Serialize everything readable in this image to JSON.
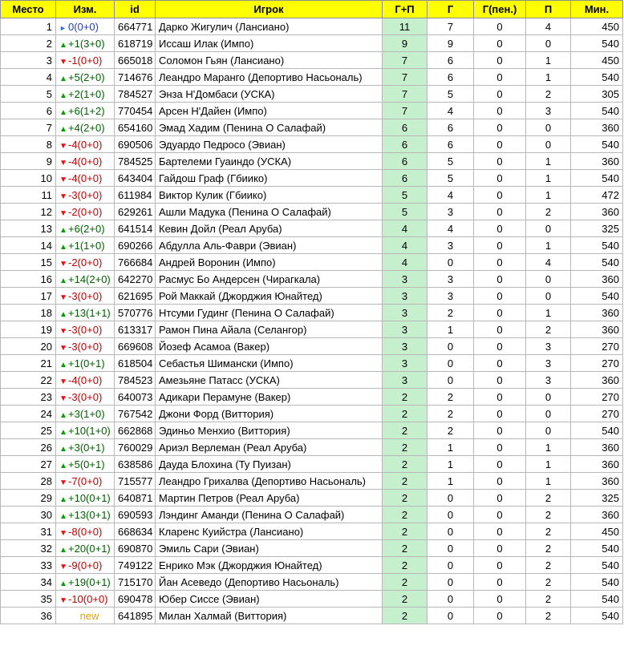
{
  "columns": {
    "place": "Место",
    "change": "Изм.",
    "id": "id",
    "player": "Игрок",
    "gp": "Г+П",
    "goals": "Г",
    "pen": "Г(пен.)",
    "assists": "П",
    "minutes": "Мин."
  },
  "rows": [
    {
      "place": "1",
      "dir": "same",
      "arrow": "►",
      "change": "0(0+0)",
      "id": "664771",
      "player": "Дарко Жигулич (Лансиано)",
      "gp": "11",
      "goals": "7",
      "pen": "0",
      "assists": "4",
      "minutes": "450"
    },
    {
      "place": "2",
      "dir": "up",
      "arrow": "▲",
      "change": "+1(3+0)",
      "id": "618719",
      "player": "Иссаш Илак (Импо)",
      "gp": "9",
      "goals": "9",
      "pen": "0",
      "assists": "0",
      "minutes": "540"
    },
    {
      "place": "3",
      "dir": "down",
      "arrow": "▼",
      "change": "-1(0+0)",
      "id": "665018",
      "player": "Соломон Гьян (Лансиано)",
      "gp": "7",
      "goals": "6",
      "pen": "0",
      "assists": "1",
      "minutes": "450"
    },
    {
      "place": "4",
      "dir": "up",
      "arrow": "▲",
      "change": "+5(2+0)",
      "id": "714676",
      "player": "Леандро Маранго (Депортиво Насьональ)",
      "gp": "7",
      "goals": "6",
      "pen": "0",
      "assists": "1",
      "minutes": "540"
    },
    {
      "place": "5",
      "dir": "up",
      "arrow": "▲",
      "change": "+2(1+0)",
      "id": "784527",
      "player": "Энза Н'Домбаси (УСКА)",
      "gp": "7",
      "goals": "5",
      "pen": "0",
      "assists": "2",
      "minutes": "305"
    },
    {
      "place": "6",
      "dir": "up",
      "arrow": "▲",
      "change": "+6(1+2)",
      "id": "770454",
      "player": "Арсен Н'Дайен (Импо)",
      "gp": "7",
      "goals": "4",
      "pen": "0",
      "assists": "3",
      "minutes": "540"
    },
    {
      "place": "7",
      "dir": "up",
      "arrow": "▲",
      "change": "+4(2+0)",
      "id": "654160",
      "player": "Эмад Хадим (Пенина О Салафай)",
      "gp": "6",
      "goals": "6",
      "pen": "0",
      "assists": "0",
      "minutes": "360"
    },
    {
      "place": "8",
      "dir": "down",
      "arrow": "▼",
      "change": "-4(0+0)",
      "id": "690506",
      "player": "Эдуардо Педросо (Эвиан)",
      "gp": "6",
      "goals": "6",
      "pen": "0",
      "assists": "0",
      "minutes": "540"
    },
    {
      "place": "9",
      "dir": "down",
      "arrow": "▼",
      "change": "-4(0+0)",
      "id": "784525",
      "player": "Бартелеми Гуаиндо (УСКА)",
      "gp": "6",
      "goals": "5",
      "pen": "0",
      "assists": "1",
      "minutes": "360"
    },
    {
      "place": "10",
      "dir": "down",
      "arrow": "▼",
      "change": "-4(0+0)",
      "id": "643404",
      "player": "Гайдош Граф (Гбиико)",
      "gp": "6",
      "goals": "5",
      "pen": "0",
      "assists": "1",
      "minutes": "540"
    },
    {
      "place": "11",
      "dir": "down",
      "arrow": "▼",
      "change": "-3(0+0)",
      "id": "611984",
      "player": "Виктор Кулик (Гбиико)",
      "gp": "5",
      "goals": "4",
      "pen": "0",
      "assists": "1",
      "minutes": "472"
    },
    {
      "place": "12",
      "dir": "down",
      "arrow": "▼",
      "change": "-2(0+0)",
      "id": "629261",
      "player": "Ашли Мадука (Пенина О Салафай)",
      "gp": "5",
      "goals": "3",
      "pen": "0",
      "assists": "2",
      "minutes": "360"
    },
    {
      "place": "13",
      "dir": "up",
      "arrow": "▲",
      "change": "+6(2+0)",
      "id": "641514",
      "player": "Кевин Дойл (Реал Аруба)",
      "gp": "4",
      "goals": "4",
      "pen": "0",
      "assists": "0",
      "minutes": "325"
    },
    {
      "place": "14",
      "dir": "up",
      "arrow": "▲",
      "change": "+1(1+0)",
      "id": "690266",
      "player": "Абдулла Аль-Фаври (Эвиан)",
      "gp": "4",
      "goals": "3",
      "pen": "0",
      "assists": "1",
      "minutes": "540"
    },
    {
      "place": "15",
      "dir": "down",
      "arrow": "▼",
      "change": "-2(0+0)",
      "id": "766684",
      "player": "Андрей Воронин (Импо)",
      "gp": "4",
      "goals": "0",
      "pen": "0",
      "assists": "4",
      "minutes": "540"
    },
    {
      "place": "16",
      "dir": "up",
      "arrow": "▲",
      "change": "+14(2+0)",
      "id": "642270",
      "player": "Расмус Бо Андерсен (Чирагкала)",
      "gp": "3",
      "goals": "3",
      "pen": "0",
      "assists": "0",
      "minutes": "360"
    },
    {
      "place": "17",
      "dir": "down",
      "arrow": "▼",
      "change": "-3(0+0)",
      "id": "621695",
      "player": "Рой Маккай (Джорджия Юнайтед)",
      "gp": "3",
      "goals": "3",
      "pen": "0",
      "assists": "0",
      "minutes": "540"
    },
    {
      "place": "18",
      "dir": "up",
      "arrow": "▲",
      "change": "+13(1+1)",
      "id": "570776",
      "player": "Нтсуми Гудинг (Пенина О Салафай)",
      "gp": "3",
      "goals": "2",
      "pen": "0",
      "assists": "1",
      "minutes": "360"
    },
    {
      "place": "19",
      "dir": "down",
      "arrow": "▼",
      "change": "-3(0+0)",
      "id": "613317",
      "player": "Рамон Пина Айала (Селангор)",
      "gp": "3",
      "goals": "1",
      "pen": "0",
      "assists": "2",
      "minutes": "360"
    },
    {
      "place": "20",
      "dir": "down",
      "arrow": "▼",
      "change": "-3(0+0)",
      "id": "669608",
      "player": "Йозеф Асамоа (Вакер)",
      "gp": "3",
      "goals": "0",
      "pen": "0",
      "assists": "3",
      "minutes": "270"
    },
    {
      "place": "21",
      "dir": "up",
      "arrow": "▲",
      "change": "+1(0+1)",
      "id": "618504",
      "player": "Себастья Шимански (Импо)",
      "gp": "3",
      "goals": "0",
      "pen": "0",
      "assists": "3",
      "minutes": "270"
    },
    {
      "place": "22",
      "dir": "down",
      "arrow": "▼",
      "change": "-4(0+0)",
      "id": "784523",
      "player": "Амезьяне Патасс (УСКА)",
      "gp": "3",
      "goals": "0",
      "pen": "0",
      "assists": "3",
      "minutes": "360"
    },
    {
      "place": "23",
      "dir": "down",
      "arrow": "▼",
      "change": "-3(0+0)",
      "id": "640073",
      "player": "Адикари Перамуне (Вакер)",
      "gp": "2",
      "goals": "2",
      "pen": "0",
      "assists": "0",
      "minutes": "270"
    },
    {
      "place": "24",
      "dir": "up",
      "arrow": "▲",
      "change": "+3(1+0)",
      "id": "767542",
      "player": "Джони Форд (Виттория)",
      "gp": "2",
      "goals": "2",
      "pen": "0",
      "assists": "0",
      "minutes": "270"
    },
    {
      "place": "25",
      "dir": "up",
      "arrow": "▲",
      "change": "+10(1+0)",
      "id": "662868",
      "player": "Эдиньо Менхио (Виттория)",
      "gp": "2",
      "goals": "2",
      "pen": "0",
      "assists": "0",
      "minutes": "540"
    },
    {
      "place": "26",
      "dir": "up",
      "arrow": "▲",
      "change": "+3(0+1)",
      "id": "760029",
      "player": "Ариэл Верлеман (Реал Аруба)",
      "gp": "2",
      "goals": "1",
      "pen": "0",
      "assists": "1",
      "minutes": "360"
    },
    {
      "place": "27",
      "dir": "up",
      "arrow": "▲",
      "change": "+5(0+1)",
      "id": "638586",
      "player": "Дауда Блохина (Ту Пуизан)",
      "gp": "2",
      "goals": "1",
      "pen": "0",
      "assists": "1",
      "minutes": "360"
    },
    {
      "place": "28",
      "dir": "down",
      "arrow": "▼",
      "change": "-7(0+0)",
      "id": "715577",
      "player": "Леандро Грихалва (Депортиво Насьональ)",
      "gp": "2",
      "goals": "1",
      "pen": "0",
      "assists": "1",
      "minutes": "360"
    },
    {
      "place": "29",
      "dir": "up",
      "arrow": "▲",
      "change": "+10(0+1)",
      "id": "640871",
      "player": "Мартин Петров (Реал Аруба)",
      "gp": "2",
      "goals": "0",
      "pen": "0",
      "assists": "2",
      "minutes": "325"
    },
    {
      "place": "30",
      "dir": "up",
      "arrow": "▲",
      "change": "+13(0+1)",
      "id": "690593",
      "player": "Лэндинг Аманди (Пенина О Салафай)",
      "gp": "2",
      "goals": "0",
      "pen": "0",
      "assists": "2",
      "minutes": "360"
    },
    {
      "place": "31",
      "dir": "down",
      "arrow": "▼",
      "change": "-8(0+0)",
      "id": "668634",
      "player": "Кларенс Куийстра (Лансиано)",
      "gp": "2",
      "goals": "0",
      "pen": "0",
      "assists": "2",
      "minutes": "450"
    },
    {
      "place": "32",
      "dir": "up",
      "arrow": "▲",
      "change": "+20(0+1)",
      "id": "690870",
      "player": "Эмиль Сари (Эвиан)",
      "gp": "2",
      "goals": "0",
      "pen": "0",
      "assists": "2",
      "minutes": "540"
    },
    {
      "place": "33",
      "dir": "down",
      "arrow": "▼",
      "change": "-9(0+0)",
      "id": "749122",
      "player": "Енрико Мэк (Джорджия Юнайтед)",
      "gp": "2",
      "goals": "0",
      "pen": "0",
      "assists": "2",
      "minutes": "540"
    },
    {
      "place": "34",
      "dir": "up",
      "arrow": "▲",
      "change": "+19(0+1)",
      "id": "715170",
      "player": "Йан Асеведо (Депортиво Насьональ)",
      "gp": "2",
      "goals": "0",
      "pen": "0",
      "assists": "2",
      "minutes": "540"
    },
    {
      "place": "35",
      "dir": "down",
      "arrow": "▼",
      "change": "-10(0+0)",
      "id": "690478",
      "player": "Юбер Сиссе (Эвиан)",
      "gp": "2",
      "goals": "0",
      "pen": "0",
      "assists": "2",
      "minutes": "540"
    },
    {
      "place": "36",
      "dir": "new",
      "arrow": "",
      "change": "new",
      "id": "641895",
      "player": "Милан Халмай (Виттория)",
      "gp": "2",
      "goals": "0",
      "pen": "0",
      "assists": "2",
      "minutes": "540"
    }
  ]
}
